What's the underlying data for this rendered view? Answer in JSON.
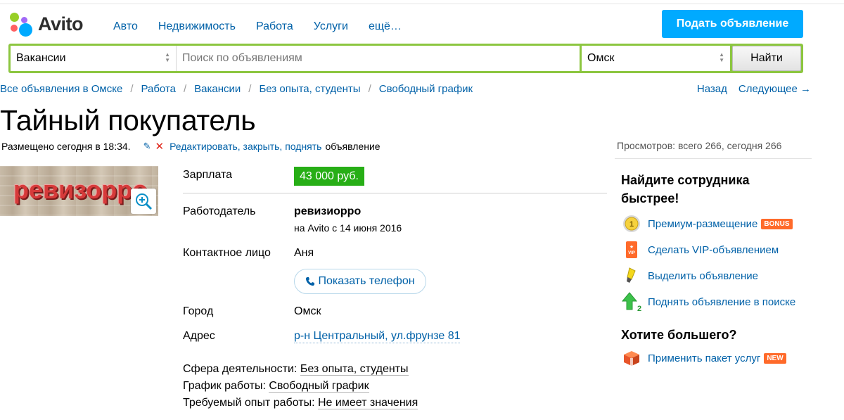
{
  "header": {
    "logo_text": "Avito",
    "nav": [
      "Авто",
      "Недвижимость",
      "Работа",
      "Услуги",
      "ещё…"
    ],
    "post_button": "Подать объявление",
    "colors": {
      "accent": "#00aaff",
      "search_border": "#8cc63f",
      "price_bg": "#27ae16",
      "link": "#0061a8"
    }
  },
  "search": {
    "category_value": "Вакансии",
    "query_placeholder": "Поиск по объявлениям",
    "city_value": "Омск",
    "find_button": "Найти"
  },
  "breadcrumbs": [
    "Все объявления в Омске",
    "Работа",
    "Вакансии",
    "Без опыта, студенты",
    "Свободный график"
  ],
  "pager": {
    "back": "Назад",
    "next": "Следующее →"
  },
  "ad": {
    "title": "Тайный покупатель",
    "posted": "Размещено сегодня в 18:34.",
    "edit_link": "Редактировать, закрыть, поднять",
    "edit_suffix": "объявление",
    "views": "Просмотров: всего 266, сегодня 266",
    "photo_text": "ревизорро",
    "details": {
      "salary_label": "Зарплата",
      "salary_value": "43 000 руб.",
      "employer_label": "Работодатель",
      "employer_name": "ревизиорро",
      "employer_since": "на Avito с 14 июня 2016",
      "contact_label": "Контактное лицо",
      "contact_value": "Аня",
      "phone_button": "Показать телефон",
      "city_label": "Город",
      "city_value": "Омск",
      "address_label": "Адрес",
      "address_value": "р-н Центральный, ул.фрунзе 81"
    },
    "properties": [
      {
        "label": "Сфера деятельности:",
        "value": "Без опыта, студенты"
      },
      {
        "label": "График работы:",
        "value": "Свободный график"
      },
      {
        "label": "Требуемый опыт работы:",
        "value": "Не имеет значения"
      }
    ]
  },
  "sidebar": {
    "heading1_line1": "Найдите сотрудника",
    "heading1_line2": "быстрее!",
    "items": [
      {
        "label": "Премиум-размещение",
        "badge": "BONUS",
        "icon": "premium-coin-icon"
      },
      {
        "label": "Сделать VIP-объявлением",
        "icon": "vip-icon"
      },
      {
        "label": "Выделить объявление",
        "icon": "highlighter-icon"
      },
      {
        "label": "Поднять объявление в поиске",
        "icon": "arrow-up-icon"
      }
    ],
    "heading2": "Хотите большего?",
    "package_item": {
      "label": "Применить пакет услуг",
      "badge": "NEW",
      "icon": "package-box-icon"
    }
  }
}
